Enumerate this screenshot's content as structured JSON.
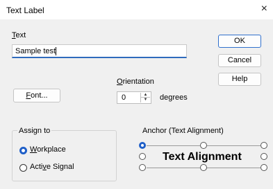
{
  "window": {
    "title": "Text Label",
    "close_icon": "×"
  },
  "text_section": {
    "label": "Text",
    "value": "Sample test"
  },
  "buttons": {
    "ok": "OK",
    "cancel": "Cancel",
    "help": "Help",
    "font": "Font..."
  },
  "orientation": {
    "label": "Orientation",
    "value": "0",
    "unit": "degrees"
  },
  "assign_to": {
    "title": "Assign to",
    "options": [
      {
        "label": "Workplace",
        "selected": true
      },
      {
        "label": "Active Signal",
        "selected": false
      }
    ]
  },
  "anchor": {
    "title": "Anchor (Text Alignment)",
    "preview_text": "Text Alignment",
    "selected": "top-left"
  },
  "colors": {
    "accent": "#1f5fc8",
    "background": "#f0f0f0"
  }
}
